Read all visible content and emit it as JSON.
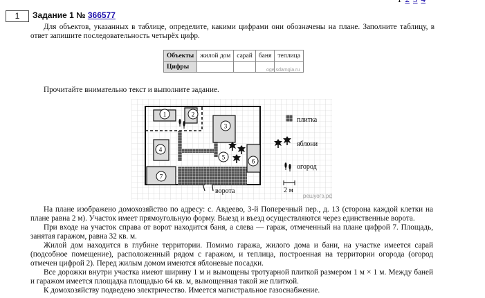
{
  "pager": {
    "current": "1",
    "links": [
      "2",
      "3",
      "4"
    ]
  },
  "task": {
    "number": "1",
    "title": "Задание 1 №",
    "id": "366577"
  },
  "instruction": "Для объектов, указанных в таблице, определите, какими цифрами они обозначены на плане. Заполните таблицу, в ответ запишите последовательность четырёх цифр.",
  "table": {
    "row1_header": "Объекты",
    "columns": [
      "жилой дом",
      "сарай",
      "баня",
      "теплица"
    ],
    "row2_header": "Цифры",
    "watermark": "oge.sdamgia.ru"
  },
  "read_prompt": "Прочитайте внимательно текст и выполните задание.",
  "plan": {
    "numbers": [
      "1",
      "2",
      "3",
      "4",
      "5",
      "6",
      "7"
    ],
    "legend_tile": "плитка",
    "legend_apple": "яблони",
    "legend_garden": "огород",
    "gate_label": "ворота",
    "scale_label": "2 м",
    "watermark": "решуогэ.рф"
  },
  "text": [
    "На плане изображено домохозяйство по адресу: с. Авдеево, 3-й Поперечный пер., д. 13 (сторона каждой клетки на плане равна 2 м). Участок имеет прямоугольную форму. Выезд и въезд осуществляются через единственные ворота.",
    "При входе на участок справа от ворот находится баня, а слева — гараж, отмеченный на плане цифрой 7. Площадь, занятая гаражом, равна 32 кв. м.",
    "Жилой дом находится в глубине территории. Помимо гаража, жилого дома и бани, на участке имеется сарай (подсобное помещение), расположенный рядом с гаражом, и теплица, построенная на территории огорода (огород отмечен цифрой 2). Перед жилым домом имеются яблоневые посадки.",
    "Все дорожки внутри участка имеют ширину 1 м и вымощены тротуарной плиткой размером 1 м × 1 м. Между баней и гаражом имеется площадка площадью 64 кв. м, вымощенная такой же плиткой.",
    "К домохозяйству подведено электричество. Имеется магистральное газоснабжение."
  ]
}
